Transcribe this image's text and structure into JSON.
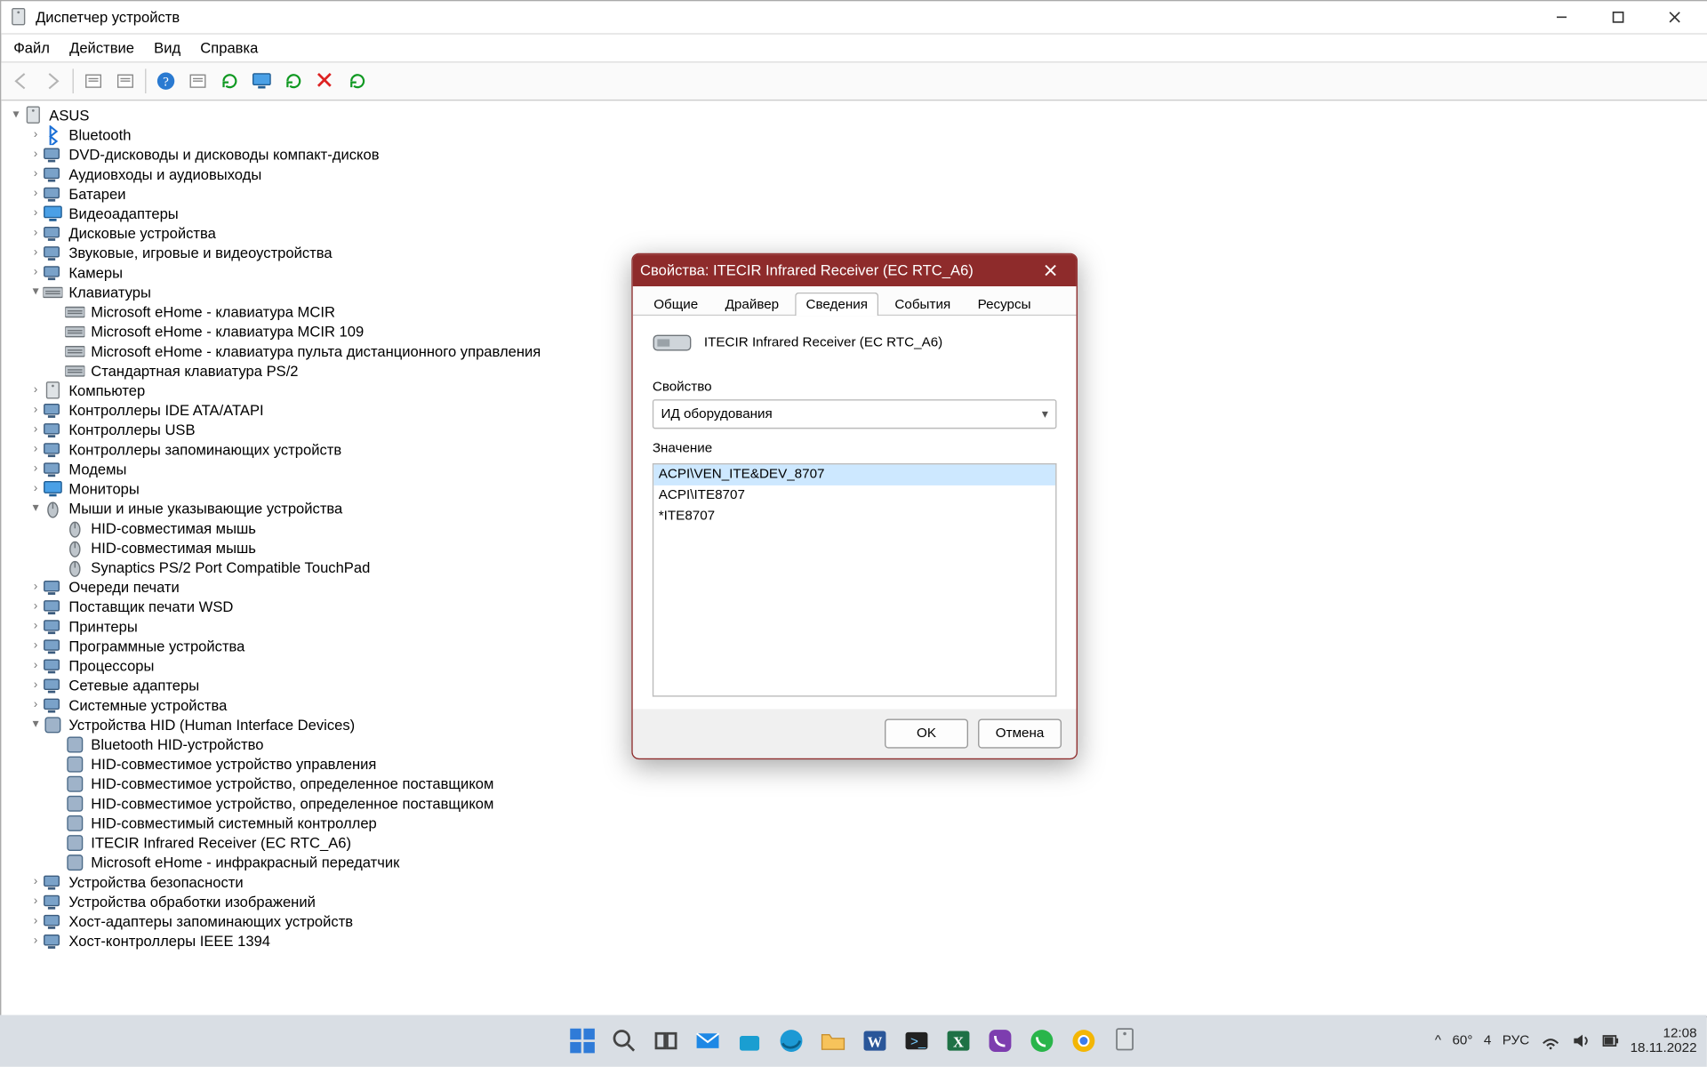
{
  "window": {
    "title": "Диспетчер устройств"
  },
  "menu": {
    "file": "Файл",
    "action": "Действие",
    "view": "Вид",
    "help": "Справка"
  },
  "tree": {
    "root": "ASUS",
    "cat": {
      "bluetooth": "Bluetooth",
      "dvd": "DVD-дисководы и дисководы компакт-дисков",
      "audio": "Аудиовходы и аудиовыходы",
      "battery": "Батареи",
      "video": "Видеоадаптеры",
      "disk": "Дисковые устройства",
      "sound": "Звуковые, игровые и видеоустройства",
      "camera": "Камеры",
      "keyboard": "Клавиатуры",
      "kb0": "Microsoft eHome - клавиатура MCIR",
      "kb1": "Microsoft eHome - клавиатура MCIR 109",
      "kb2": "Microsoft eHome - клавиатура пульта дистанционного управления",
      "kb3": "Стандартная клавиатура PS/2",
      "computer": "Компьютер",
      "ide": "Контроллеры IDE ATA/ATAPI",
      "usb": "Контроллеры USB",
      "storagectl": "Контроллеры запоминающих устройств",
      "modem": "Модемы",
      "monitor": "Мониторы",
      "mouse": "Мыши и иные указывающие устройства",
      "m0": "HID-совместимая мышь",
      "m1": "HID-совместимая мышь",
      "m2": "Synaptics PS/2 Port Compatible TouchPad",
      "printq": "Очереди печати",
      "wsd": "Поставщик печати WSD",
      "printer": "Принтеры",
      "software": "Программные устройства",
      "cpu": "Процессоры",
      "net": "Сетевые адаптеры",
      "system": "Системные устройства",
      "hid": "Устройства HID (Human Interface Devices)",
      "h0": "Bluetooth HID-устройство",
      "h1": "HID-совместимое устройство управления",
      "h2": "HID-совместимое устройство, определенное поставщиком",
      "h3": "HID-совместимое устройство, определенное поставщиком",
      "h4": "HID-совместимый системный контроллер",
      "h5": "ITECIR Infrared Receiver (EC RTC_A6)",
      "h6": "Microsoft eHome - инфракрасный передатчик",
      "security": "Устройства безопасности",
      "imaging": "Устройства обработки изображений",
      "storagehost": "Хост-адаптеры запоминающих устройств",
      "ieee1394": "Хост-контроллеры IEEE 1394"
    }
  },
  "dlg": {
    "title": "Свойства: ITECIR Infrared Receiver (EC RTC_A6)",
    "device": "ITECIR Infrared Receiver (EC RTC_A6)",
    "tabs": {
      "general": "Общие",
      "driver": "Драйвер",
      "details": "Сведения",
      "events": "События",
      "resources": "Ресурсы"
    },
    "propLabel": "Свойство",
    "propValue": "ИД оборудования",
    "valueLabel": "Значение",
    "values": [
      "ACPI\\VEN_ITE&DEV_8707",
      "ACPI\\ITE8707",
      "*ITE8707"
    ],
    "ok": "OK",
    "cancel": "Отмена"
  },
  "tray": {
    "chev": "^",
    "temp": "60",
    "num": "4",
    "lang": "РУС",
    "time": "12:08",
    "date": "18.11.2022"
  }
}
